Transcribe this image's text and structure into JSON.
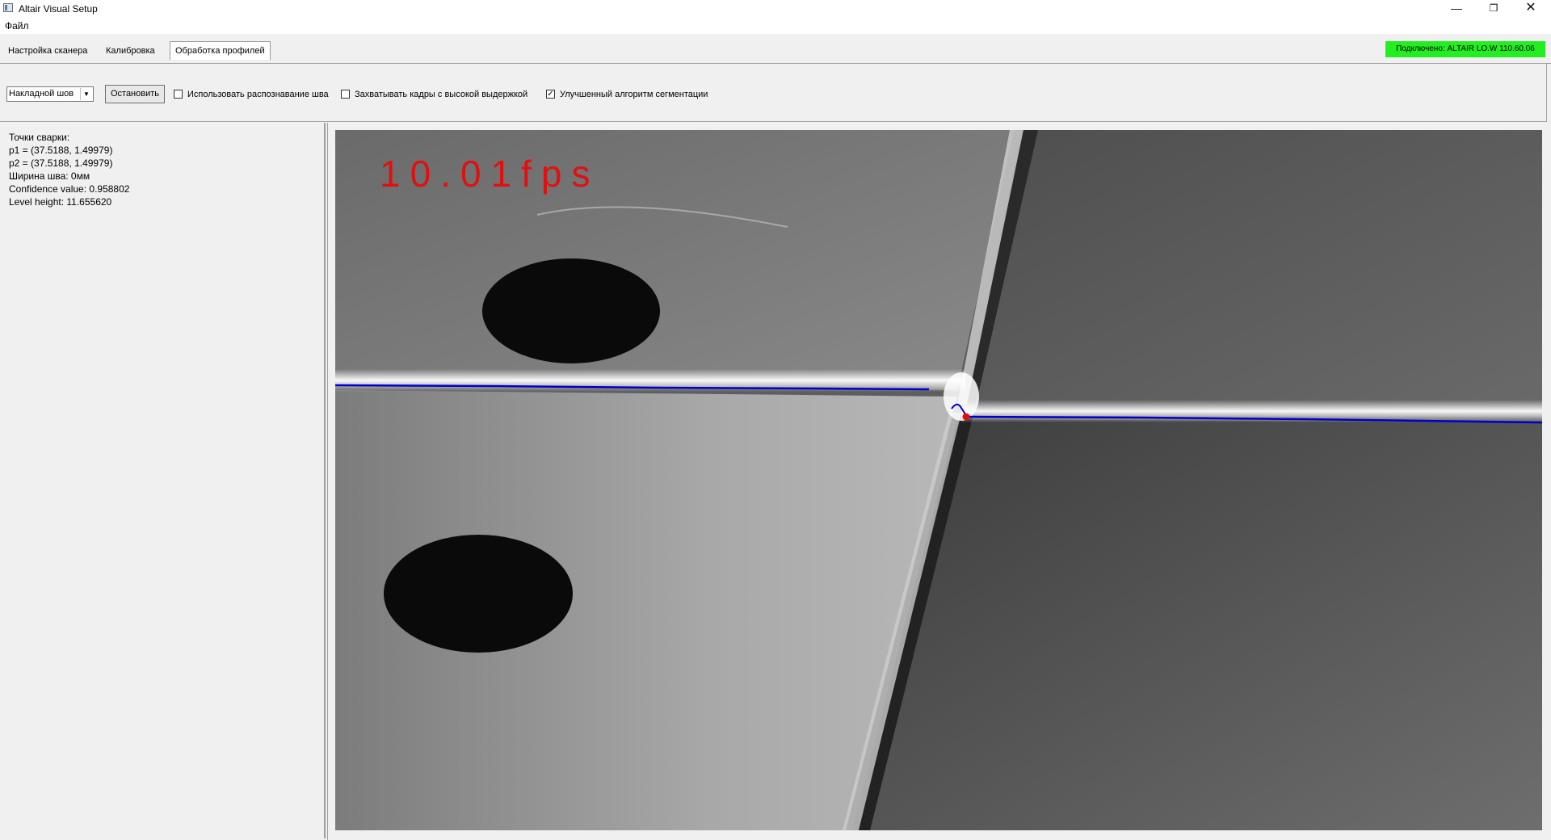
{
  "window": {
    "title": "Altair Visual Setup"
  },
  "menu": {
    "file": "Файл"
  },
  "tabs": [
    "Настройка сканера",
    "Калибровка",
    "Обработка профилей"
  ],
  "status": {
    "connection": "Подключено: ALTAIR LO.W 110.60.06",
    "color": "#22ee22"
  },
  "toolbar": {
    "seam_type": "Накладной шов",
    "stop_button": "Остановить",
    "checkboxes": [
      {
        "label": "Использовать распознавание шва",
        "checked": false
      },
      {
        "label": "Захватывать кадры с высокой выдержкой",
        "checked": false
      },
      {
        "label": "Улучшенный алгоритм сегментации",
        "checked": true
      }
    ]
  },
  "info": {
    "lines": [
      "Точки сварки:",
      "p1 = (37.5188, 1.49979)",
      "p2 = (37.5188, 1.49979)",
      "Ширина шва: 0мм",
      "Confidence value: 0.958802",
      "Level height: 11.655620"
    ]
  },
  "camera": {
    "fps_text": "10.01fps",
    "fps_color": "#e01010",
    "profile_color": "#0000cc",
    "weld_point_color": "#dd1111"
  }
}
